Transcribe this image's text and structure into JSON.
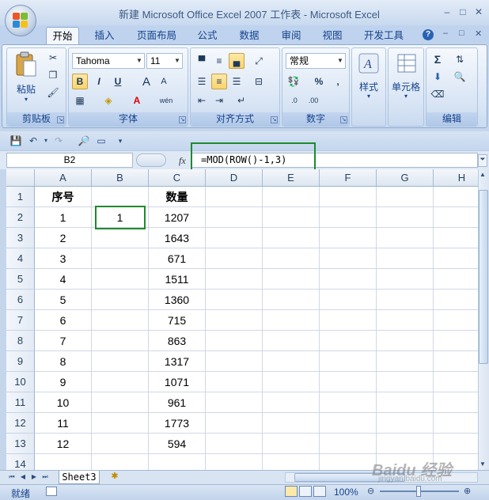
{
  "window": {
    "title": "新建 Microsoft Office Excel 2007 工作表 - Microsoft Excel",
    "minimize": "–",
    "restore": "□",
    "close": "✕"
  },
  "tabs": [
    {
      "label": "开始",
      "active": true
    },
    {
      "label": "插入"
    },
    {
      "label": "页面布局"
    },
    {
      "label": "公式"
    },
    {
      "label": "数据"
    },
    {
      "label": "审阅"
    },
    {
      "label": "视图"
    },
    {
      "label": "开发工具"
    }
  ],
  "ribbon": {
    "clipboard": {
      "label": "剪贴板",
      "paste": "粘贴"
    },
    "font": {
      "label": "字体",
      "font_name": "Tahoma",
      "font_size": "11",
      "bold": "B",
      "italic": "I",
      "underline": "U",
      "grow": "A",
      "shrink": "A",
      "wen": "wén"
    },
    "alignment": {
      "label": "对齐方式"
    },
    "number": {
      "label": "数字",
      "format": "常规",
      "percent": "%",
      "comma": ","
    },
    "styles": {
      "label": "样式"
    },
    "cells": {
      "label": "单元格"
    },
    "editing": {
      "label": "编辑",
      "sigma": "Σ"
    }
  },
  "formula_bar": {
    "name_box": "B2",
    "fx": "fx",
    "formula": "=MOD(ROW()-1,3)"
  },
  "grid": {
    "columns": [
      "A",
      "B",
      "C",
      "D",
      "E",
      "F",
      "G",
      "H"
    ],
    "rows": [
      "1",
      "2",
      "3",
      "4",
      "5",
      "6",
      "7",
      "8",
      "9",
      "10",
      "11",
      "12",
      "13",
      "14"
    ],
    "header_row": {
      "a": "序号",
      "b": "",
      "c": "数量"
    },
    "data": [
      {
        "a": "1",
        "b": "1",
        "c": "1207"
      },
      {
        "a": "2",
        "b": "",
        "c": "1643"
      },
      {
        "a": "3",
        "b": "",
        "c": "671"
      },
      {
        "a": "4",
        "b": "",
        "c": "1511"
      },
      {
        "a": "5",
        "b": "",
        "c": "1360"
      },
      {
        "a": "6",
        "b": "",
        "c": "715"
      },
      {
        "a": "7",
        "b": "",
        "c": "863"
      },
      {
        "a": "8",
        "b": "",
        "c": "1317"
      },
      {
        "a": "9",
        "b": "",
        "c": "1071"
      },
      {
        "a": "10",
        "b": "",
        "c": "961"
      },
      {
        "a": "11",
        "b": "",
        "c": "1773"
      },
      {
        "a": "12",
        "b": "",
        "c": "594"
      }
    ]
  },
  "sheets": {
    "active": "Sheet3"
  },
  "status": {
    "ready": "就绪",
    "zoom": "100%"
  },
  "watermark": {
    "line1": "Baidu 经验",
    "line2": "jingyan.baidu.com"
  },
  "colors": {
    "highlight": "#1e8a2e",
    "ribbon_text": "#15428b"
  }
}
